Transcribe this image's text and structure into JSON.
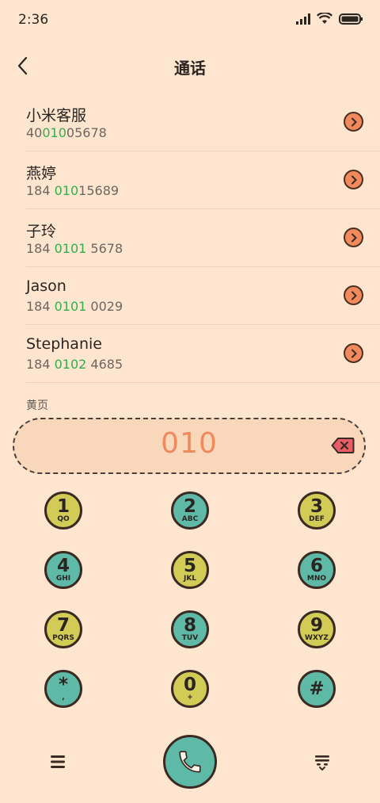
{
  "status": {
    "time": "2:36"
  },
  "header": {
    "title": "通话"
  },
  "contacts": [
    {
      "name": "小米客服",
      "num_pre": "40",
      "num_hl": "010",
      "num_post": "05678"
    },
    {
      "name": "燕婷",
      "num_pre": "184 ",
      "num_hl": "010",
      "num_post": "15689"
    },
    {
      "name": "子玲",
      "num_pre": "184 ",
      "num_hl": "0101",
      "num_post": " 5678"
    },
    {
      "name": "Jason",
      "num_pre": "184 ",
      "num_hl": "0101",
      "num_post": " 0029"
    },
    {
      "name": "Stephanie",
      "num_pre": "184 ",
      "num_hl": "0102",
      "num_post": " 4685"
    }
  ],
  "section_label": "黄页",
  "dial": {
    "input": "010"
  },
  "keys": [
    {
      "digit": "1",
      "letters": "QO"
    },
    {
      "digit": "2",
      "letters": "ABC"
    },
    {
      "digit": "3",
      "letters": "DEF"
    },
    {
      "digit": "4",
      "letters": "GHI"
    },
    {
      "digit": "5",
      "letters": "JKL"
    },
    {
      "digit": "6",
      "letters": "MNO"
    },
    {
      "digit": "7",
      "letters": "PQRS"
    },
    {
      "digit": "8",
      "letters": "TUV"
    },
    {
      "digit": "9",
      "letters": "WXYZ"
    },
    {
      "digit": "*",
      "letters": ","
    },
    {
      "digit": "0",
      "letters": "+"
    },
    {
      "digit": "#",
      "letters": ""
    }
  ],
  "icons": {
    "back": "back-arrow-icon",
    "arrow": "chevron-right-icon",
    "backspace": "backspace-icon",
    "menu": "menu-icon",
    "call": "phone-icon",
    "dialpad": "dialpad-toggle-icon"
  },
  "colors": {
    "background": "#fde5cf",
    "accent_orange": "#f08a5d",
    "highlight_green": "#2fb04a",
    "key_yellow": "#d2cb55",
    "key_teal": "#5ebaa7"
  }
}
